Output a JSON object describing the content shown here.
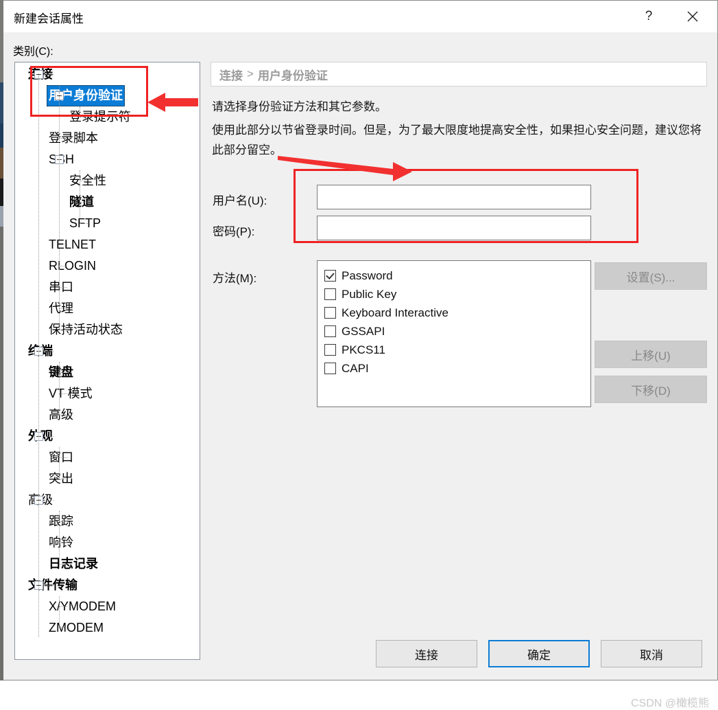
{
  "window": {
    "title": "新建会话属性",
    "help_label": "?",
    "close_label": "×"
  },
  "category": {
    "label": "类别(C):",
    "tree": [
      {
        "label": "连接",
        "level": 0,
        "expander": "minus",
        "bold": true,
        "selected": false
      },
      {
        "label": "用户身份验证",
        "level": 1,
        "expander": "minus",
        "bold": true,
        "selected": true
      },
      {
        "label": "登录提示符",
        "level": 2,
        "expander": "none",
        "bold": false,
        "selected": false
      },
      {
        "label": "登录脚本",
        "level": 1,
        "expander": "none",
        "bold": false,
        "selected": false
      },
      {
        "label": "SSH",
        "level": 1,
        "expander": "minus",
        "bold": false,
        "selected": false
      },
      {
        "label": "安全性",
        "level": 2,
        "expander": "none",
        "bold": false,
        "selected": false
      },
      {
        "label": "隧道",
        "level": 2,
        "expander": "none",
        "bold": true,
        "selected": false
      },
      {
        "label": "SFTP",
        "level": 2,
        "expander": "none",
        "bold": false,
        "selected": false
      },
      {
        "label": "TELNET",
        "level": 1,
        "expander": "none",
        "bold": false,
        "selected": false
      },
      {
        "label": "RLOGIN",
        "level": 1,
        "expander": "none",
        "bold": false,
        "selected": false
      },
      {
        "label": "串口",
        "level": 1,
        "expander": "none",
        "bold": false,
        "selected": false
      },
      {
        "label": "代理",
        "level": 1,
        "expander": "none",
        "bold": false,
        "selected": false
      },
      {
        "label": "保持活动状态",
        "level": 1,
        "expander": "none",
        "bold": false,
        "selected": false
      },
      {
        "label": "终端",
        "level": 0,
        "expander": "minus",
        "bold": true,
        "selected": false
      },
      {
        "label": "键盘",
        "level": 1,
        "expander": "none",
        "bold": true,
        "selected": false
      },
      {
        "label": "VT 模式",
        "level": 1,
        "expander": "none",
        "bold": false,
        "selected": false
      },
      {
        "label": "高级",
        "level": 1,
        "expander": "none",
        "bold": false,
        "selected": false
      },
      {
        "label": "外观",
        "level": 0,
        "expander": "minus",
        "bold": true,
        "selected": false
      },
      {
        "label": "窗口",
        "level": 1,
        "expander": "none",
        "bold": false,
        "selected": false
      },
      {
        "label": "突出",
        "level": 1,
        "expander": "none",
        "bold": false,
        "selected": false
      },
      {
        "label": "高级",
        "level": 0,
        "expander": "minus",
        "bold": false,
        "selected": false
      },
      {
        "label": "跟踪",
        "level": 1,
        "expander": "none",
        "bold": false,
        "selected": false
      },
      {
        "label": "响铃",
        "level": 1,
        "expander": "none",
        "bold": false,
        "selected": false
      },
      {
        "label": "日志记录",
        "level": 1,
        "expander": "none",
        "bold": true,
        "selected": false
      },
      {
        "label": "文件传输",
        "level": 0,
        "expander": "minus",
        "bold": true,
        "selected": false
      },
      {
        "label": "X/YMODEM",
        "level": 1,
        "expander": "none",
        "bold": false,
        "selected": false
      },
      {
        "label": "ZMODEM",
        "level": 1,
        "expander": "none",
        "bold": false,
        "selected": false
      }
    ]
  },
  "panel": {
    "breadcrumb": {
      "parent": "连接",
      "separator": ">",
      "current": "用户身份验证"
    },
    "description_line1": "请选择身份验证方法和其它参数。",
    "description_line2": "使用此部分以节省登录时间。但是，为了最大限度地提高安全性，如果担心安全问题，建议您将此部分留空。",
    "fields": {
      "username": {
        "label": "用户名(U):",
        "value": "",
        "placeholder": ""
      },
      "password": {
        "label": "密码(P):",
        "value": "",
        "placeholder": ""
      }
    },
    "methods": {
      "label": "方法(M):",
      "items": [
        {
          "label": "Password",
          "checked": true
        },
        {
          "label": "Public Key",
          "checked": false
        },
        {
          "label": "Keyboard Interactive",
          "checked": false
        },
        {
          "label": "GSSAPI",
          "checked": false
        },
        {
          "label": "PKCS11",
          "checked": false
        },
        {
          "label": "CAPI",
          "checked": false
        }
      ]
    },
    "side_buttons": {
      "properties": "设置(S)...",
      "move_up": "上移(U)",
      "move_down": "下移(D)"
    }
  },
  "footer": {
    "connect": "连接",
    "ok": "确定",
    "cancel": "取消"
  },
  "watermark": "CSDN @橄榄熊",
  "colors": {
    "selection_blue": "#0a7cd6",
    "focus_blue": "#0c7cd5",
    "annotation_red": "#ee2222",
    "dialog_bg": "#f0f0f0",
    "disabled_text": "#888888"
  }
}
